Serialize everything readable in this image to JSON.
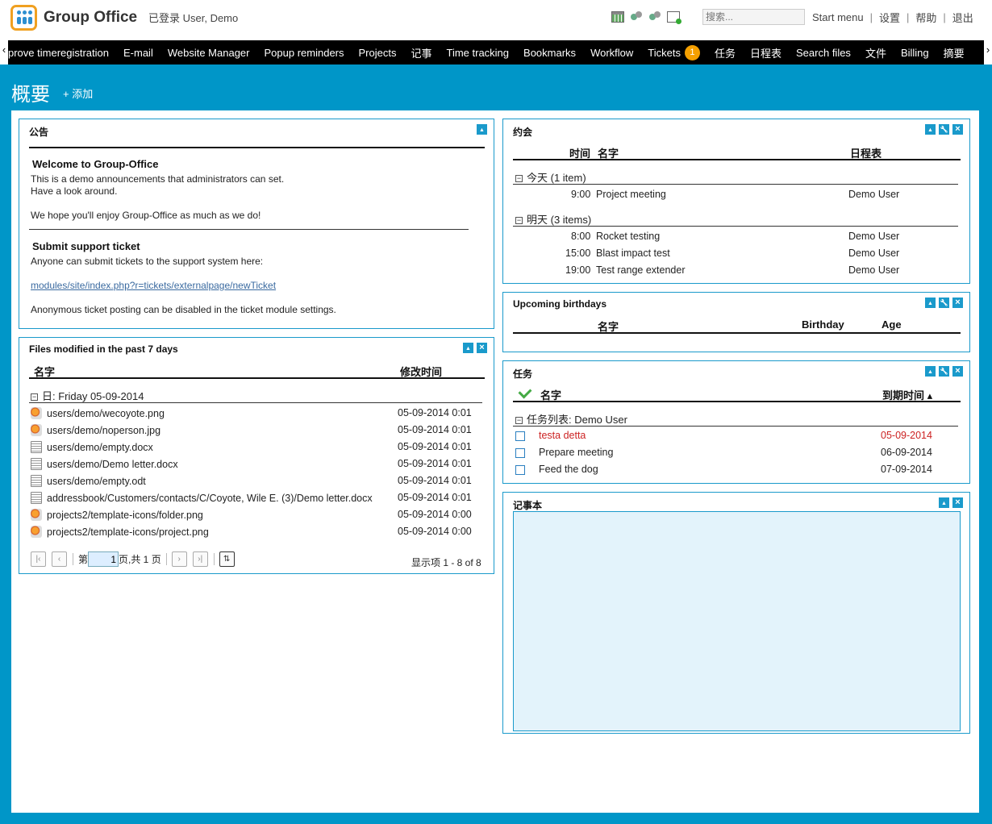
{
  "header": {
    "brand": "Group Office",
    "logged_in": "已登录 User, Demo",
    "search_placeholder": "搜索...",
    "links": [
      "Start menu",
      "设置",
      "帮助",
      "退出"
    ]
  },
  "nav": {
    "items": [
      "prove timeregistration",
      "E-mail",
      "Website Manager",
      "Popup reminders",
      "Projects",
      "记事",
      "Time tracking",
      "Bookmarks",
      "Workflow",
      "Tickets",
      "任务",
      "日程表",
      "Search files",
      "文件",
      "Billing",
      "摘要"
    ],
    "tickets_badge": "1"
  },
  "page": {
    "title": "概要",
    "add_label": "+ 添加"
  },
  "announcements": {
    "title": "公告",
    "welcome_title": "Welcome to Group-Office",
    "welcome_line1": "This is a demo announcements that administrators can set.",
    "welcome_line2": "Have a look around.",
    "welcome_line3": "We hope you'll enjoy Group-Office as much as we do!",
    "ticket_title": "Submit support ticket",
    "ticket_line1": "Anyone can submit tickets to the support system here:",
    "ticket_link": "modules/site/index.php?r=tickets/externalpage/newTicket",
    "ticket_line2": "Anonymous ticket posting can be disabled in the ticket module settings."
  },
  "files": {
    "title": "Files modified in the past 7 days",
    "col_name": "名字",
    "col_mtime": "修改时间",
    "group": "日: Friday 05-09-2014",
    "rows": [
      {
        "name": "users/demo/wecoyote.png",
        "time": "05-09-2014 0:01",
        "icon": "image-file-icon"
      },
      {
        "name": "users/demo/noperson.jpg",
        "time": "05-09-2014 0:01",
        "icon": "image-file-icon"
      },
      {
        "name": "users/demo/empty.docx",
        "time": "05-09-2014 0:01",
        "icon": "document-file-icon"
      },
      {
        "name": "users/demo/Demo letter.docx",
        "time": "05-09-2014 0:01",
        "icon": "document-file-icon"
      },
      {
        "name": "users/demo/empty.odt",
        "time": "05-09-2014 0:01",
        "icon": "document-file-icon"
      },
      {
        "name": "addressbook/Customers/contacts/C/Coyote, Wile E. (3)/Demo letter.docx",
        "time": "05-09-2014 0:01",
        "icon": "document-file-icon"
      },
      {
        "name": "projects2/template-icons/folder.png",
        "time": "05-09-2014 0:00",
        "icon": "image-file-icon"
      },
      {
        "name": "projects2/template-icons/project.png",
        "time": "05-09-2014 0:00",
        "icon": "image-file-icon"
      }
    ],
    "pager": {
      "page_prefix": "第",
      "page_value": "1",
      "page_suffix": "页,共 1 页",
      "summary": "显示项 1 - 8 of 8"
    }
  },
  "appointments": {
    "title": "约会",
    "col_time": "时间",
    "col_name": "名字",
    "col_calendar": "日程表",
    "today_group": "今天 (1 item)",
    "tomorrow_group": "明天 (3 items)",
    "today": [
      {
        "time": "9:00",
        "name": "Project meeting",
        "calendar": "Demo User"
      }
    ],
    "tomorrow": [
      {
        "time": "8:00",
        "name": "Rocket testing",
        "calendar": "Demo User"
      },
      {
        "time": "15:00",
        "name": "Blast impact test",
        "calendar": "Demo User"
      },
      {
        "time": "19:00",
        "name": "Test range extender",
        "calendar": "Demo User"
      }
    ]
  },
  "birthdays": {
    "title": "Upcoming birthdays",
    "col_name": "名字",
    "col_birthday": "Birthday",
    "col_age": "Age"
  },
  "tasks": {
    "title": "任务",
    "col_name": "名字",
    "col_due": "到期时间 ▴",
    "group": "任务列表: Demo User",
    "rows": [
      {
        "name": "testa detta",
        "due": "05-09-2014",
        "overdue": true
      },
      {
        "name": "Prepare meeting",
        "due": "06-09-2014",
        "overdue": false
      },
      {
        "name": "Feed the dog",
        "due": "07-09-2014",
        "overdue": false
      }
    ],
    "overdue_color": "#cc2222"
  },
  "notes": {
    "title": "记事本"
  },
  "colors": {
    "frame": "#0096c8",
    "nav": "#000000",
    "badge": "#f5a000"
  }
}
